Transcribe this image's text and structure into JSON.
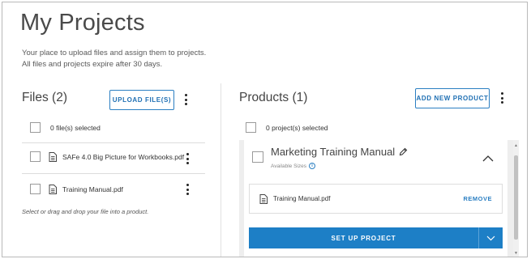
{
  "page": {
    "title": "My Projects",
    "subtitle_line1": "Your place to upload files and assign them to projects.",
    "subtitle_line2": "All files and projects expire after 30 days."
  },
  "files": {
    "heading": "Files (2)",
    "upload_label": "UPLOAD FILE(S)",
    "selected_text": "0 file(s) selected",
    "items": [
      {
        "name": "SAFe 4.0 Big Picture for Workbooks.pdf"
      },
      {
        "name": "Training Manual.pdf"
      }
    ],
    "hint": "Select or drag and drop your file into a product."
  },
  "products": {
    "heading": "Products (1)",
    "add_label": "ADD NEW PRODUCT",
    "selected_text": "0 project(s) selected",
    "items": [
      {
        "title": "Marketing Training Manual",
        "sizes_label": "Available Sizes",
        "info_glyph": "i",
        "file": "Training Manual.pdf",
        "remove_label": "REMOVE",
        "setup_label": "SET UP PROJECT"
      }
    ]
  },
  "icons": {
    "file": "document-icon",
    "edit": "pencil-icon",
    "collapse": "chevron-up-icon",
    "dropdown": "chevron-down-icon",
    "menu": "kebab-menu-icon",
    "info": "info-icon"
  },
  "colors": {
    "accent": "#1d7fc6",
    "outline": "#2b7fc2",
    "text": "#333333"
  }
}
